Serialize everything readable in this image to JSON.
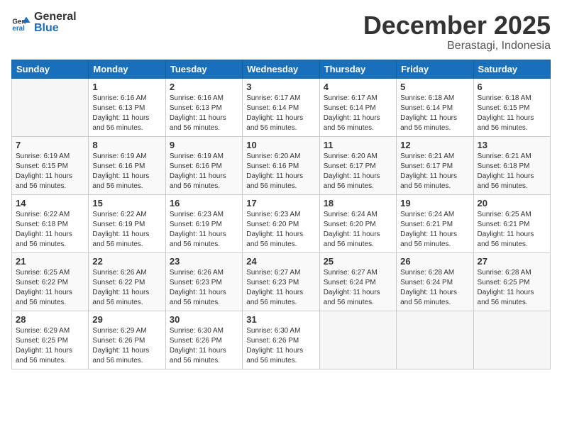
{
  "header": {
    "logo_general": "General",
    "logo_blue": "Blue",
    "month": "December 2025",
    "location": "Berastagi, Indonesia"
  },
  "weekdays": [
    "Sunday",
    "Monday",
    "Tuesday",
    "Wednesday",
    "Thursday",
    "Friday",
    "Saturday"
  ],
  "weeks": [
    [
      {
        "day": "",
        "info": ""
      },
      {
        "day": "1",
        "info": "Sunrise: 6:16 AM\nSunset: 6:13 PM\nDaylight: 11 hours\nand 56 minutes."
      },
      {
        "day": "2",
        "info": "Sunrise: 6:16 AM\nSunset: 6:13 PM\nDaylight: 11 hours\nand 56 minutes."
      },
      {
        "day": "3",
        "info": "Sunrise: 6:17 AM\nSunset: 6:14 PM\nDaylight: 11 hours\nand 56 minutes."
      },
      {
        "day": "4",
        "info": "Sunrise: 6:17 AM\nSunset: 6:14 PM\nDaylight: 11 hours\nand 56 minutes."
      },
      {
        "day": "5",
        "info": "Sunrise: 6:18 AM\nSunset: 6:14 PM\nDaylight: 11 hours\nand 56 minutes."
      },
      {
        "day": "6",
        "info": "Sunrise: 6:18 AM\nSunset: 6:15 PM\nDaylight: 11 hours\nand 56 minutes."
      }
    ],
    [
      {
        "day": "7",
        "info": "Sunrise: 6:19 AM\nSunset: 6:15 PM\nDaylight: 11 hours\nand 56 minutes."
      },
      {
        "day": "8",
        "info": "Sunrise: 6:19 AM\nSunset: 6:16 PM\nDaylight: 11 hours\nand 56 minutes."
      },
      {
        "day": "9",
        "info": "Sunrise: 6:19 AM\nSunset: 6:16 PM\nDaylight: 11 hours\nand 56 minutes."
      },
      {
        "day": "10",
        "info": "Sunrise: 6:20 AM\nSunset: 6:16 PM\nDaylight: 11 hours\nand 56 minutes."
      },
      {
        "day": "11",
        "info": "Sunrise: 6:20 AM\nSunset: 6:17 PM\nDaylight: 11 hours\nand 56 minutes."
      },
      {
        "day": "12",
        "info": "Sunrise: 6:21 AM\nSunset: 6:17 PM\nDaylight: 11 hours\nand 56 minutes."
      },
      {
        "day": "13",
        "info": "Sunrise: 6:21 AM\nSunset: 6:18 PM\nDaylight: 11 hours\nand 56 minutes."
      }
    ],
    [
      {
        "day": "14",
        "info": "Sunrise: 6:22 AM\nSunset: 6:18 PM\nDaylight: 11 hours\nand 56 minutes."
      },
      {
        "day": "15",
        "info": "Sunrise: 6:22 AM\nSunset: 6:19 PM\nDaylight: 11 hours\nand 56 minutes."
      },
      {
        "day": "16",
        "info": "Sunrise: 6:23 AM\nSunset: 6:19 PM\nDaylight: 11 hours\nand 56 minutes."
      },
      {
        "day": "17",
        "info": "Sunrise: 6:23 AM\nSunset: 6:20 PM\nDaylight: 11 hours\nand 56 minutes."
      },
      {
        "day": "18",
        "info": "Sunrise: 6:24 AM\nSunset: 6:20 PM\nDaylight: 11 hours\nand 56 minutes."
      },
      {
        "day": "19",
        "info": "Sunrise: 6:24 AM\nSunset: 6:21 PM\nDaylight: 11 hours\nand 56 minutes."
      },
      {
        "day": "20",
        "info": "Sunrise: 6:25 AM\nSunset: 6:21 PM\nDaylight: 11 hours\nand 56 minutes."
      }
    ],
    [
      {
        "day": "21",
        "info": "Sunrise: 6:25 AM\nSunset: 6:22 PM\nDaylight: 11 hours\nand 56 minutes."
      },
      {
        "day": "22",
        "info": "Sunrise: 6:26 AM\nSunset: 6:22 PM\nDaylight: 11 hours\nand 56 minutes."
      },
      {
        "day": "23",
        "info": "Sunrise: 6:26 AM\nSunset: 6:23 PM\nDaylight: 11 hours\nand 56 minutes."
      },
      {
        "day": "24",
        "info": "Sunrise: 6:27 AM\nSunset: 6:23 PM\nDaylight: 11 hours\nand 56 minutes."
      },
      {
        "day": "25",
        "info": "Sunrise: 6:27 AM\nSunset: 6:24 PM\nDaylight: 11 hours\nand 56 minutes."
      },
      {
        "day": "26",
        "info": "Sunrise: 6:28 AM\nSunset: 6:24 PM\nDaylight: 11 hours\nand 56 minutes."
      },
      {
        "day": "27",
        "info": "Sunrise: 6:28 AM\nSunset: 6:25 PM\nDaylight: 11 hours\nand 56 minutes."
      }
    ],
    [
      {
        "day": "28",
        "info": "Sunrise: 6:29 AM\nSunset: 6:25 PM\nDaylight: 11 hours\nand 56 minutes."
      },
      {
        "day": "29",
        "info": "Sunrise: 6:29 AM\nSunset: 6:26 PM\nDaylight: 11 hours\nand 56 minutes."
      },
      {
        "day": "30",
        "info": "Sunrise: 6:30 AM\nSunset: 6:26 PM\nDaylight: 11 hours\nand 56 minutes."
      },
      {
        "day": "31",
        "info": "Sunrise: 6:30 AM\nSunset: 6:26 PM\nDaylight: 11 hours\nand 56 minutes."
      },
      {
        "day": "",
        "info": ""
      },
      {
        "day": "",
        "info": ""
      },
      {
        "day": "",
        "info": ""
      }
    ]
  ]
}
